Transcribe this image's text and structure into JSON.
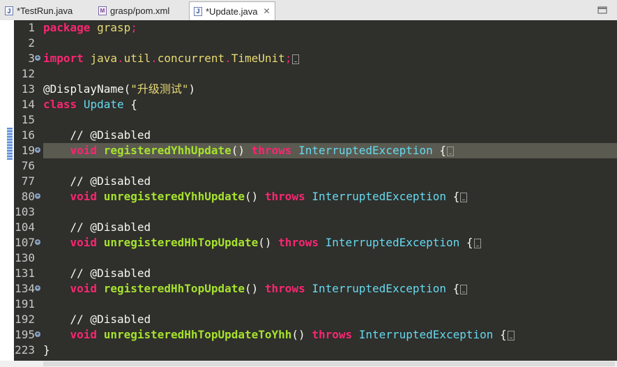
{
  "tabs": [
    {
      "label": "*TestRun.java",
      "icon": "java-file-icon"
    },
    {
      "label": "grasp/pom.xml",
      "icon": "maven-xml-icon"
    },
    {
      "label": "*Update.java",
      "icon": "java-file-icon",
      "active": true,
      "close": "✕"
    }
  ],
  "colors": {
    "editor_bg": "#2f2f2b",
    "keyword": "#f92672",
    "type": "#66d9ef",
    "method": "#a6e22e",
    "string": "#e6db74",
    "highlight_line": "#5a5a50"
  },
  "lines": [
    {
      "num": "1",
      "package_kw": "package",
      "package_name": "grasp",
      "semi": ";"
    },
    {
      "num": "2"
    },
    {
      "num": "3",
      "import_kw": "import",
      "p1": "java",
      "d1": ".",
      "p2": "util",
      "d2": ".",
      "p3": "concurrent",
      "d3": ".",
      "cls": "TimeUnit",
      "semi": ";"
    },
    {
      "num": "12"
    },
    {
      "num": "13",
      "annotation": "@DisplayName(",
      "string": "\"升级测试\"",
      "close": ")"
    },
    {
      "num": "14",
      "class_kw": "class",
      "class_name": "Update",
      "brace": " {"
    },
    {
      "num": "15"
    },
    {
      "num": "16",
      "comment": "    // @Disabled"
    },
    {
      "num": "19",
      "void_kw": "void",
      "method": "registeredYhhUpdate",
      "parens": "()",
      "throws_kw": "throws",
      "exception": "InterruptedException",
      "brace": "{"
    },
    {
      "num": "76"
    },
    {
      "num": "77",
      "comment": "    // @Disabled"
    },
    {
      "num": "80",
      "void_kw": "void",
      "method": "unregisteredYhhUpdate",
      "parens": "()",
      "throws_kw": "throws",
      "exception": "InterruptedException",
      "brace": "{"
    },
    {
      "num": "103"
    },
    {
      "num": "104",
      "comment": "    // @Disabled"
    },
    {
      "num": "107",
      "void_kw": "void",
      "method": "unregisteredHhTopUpdate",
      "parens": "()",
      "throws_kw": "throws",
      "exception": "InterruptedException",
      "brace": "{"
    },
    {
      "num": "130"
    },
    {
      "num": "131",
      "comment": "    // @Disabled"
    },
    {
      "num": "134",
      "void_kw": "void",
      "method": "registeredHhTopUpdate",
      "parens": "()",
      "throws_kw": "throws",
      "exception": "InterruptedException",
      "brace": "{"
    },
    {
      "num": "191"
    },
    {
      "num": "192",
      "comment": "    // @Disabled"
    },
    {
      "num": "195",
      "void_kw": "void",
      "method": "unregisteredHhTopUpdateToYhh",
      "parens": "()",
      "throws_kw": "throws",
      "exception": "InterruptedException",
      "brace": "{"
    },
    {
      "num": "223",
      "close_brace": "}"
    }
  ]
}
